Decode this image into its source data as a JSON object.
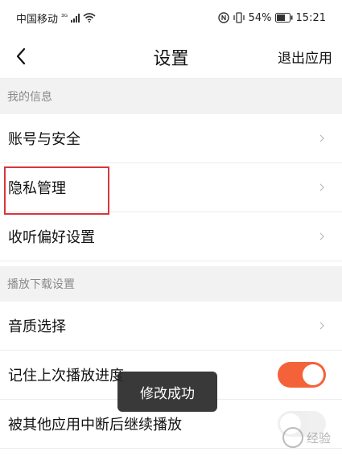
{
  "status_bar": {
    "carrier": "中国移动",
    "network": "³ᴳ",
    "battery": "54%",
    "time": "15:21"
  },
  "nav": {
    "title": "设置",
    "exit_label": "退出应用"
  },
  "sections": [
    {
      "header": "我的信息",
      "items": [
        {
          "label": "账号与安全"
        },
        {
          "label": "隐私管理"
        },
        {
          "label": "收听偏好设置"
        }
      ]
    },
    {
      "header": "播放下载设置",
      "items": [
        {
          "label": "音质选择"
        },
        {
          "label": "记住上次播放进度",
          "toggle": "on"
        },
        {
          "label": "被其他应用中断后继续播放",
          "toggle": "off"
        }
      ]
    }
  ],
  "toast": "修改成功",
  "watermark": "经验",
  "colors": {
    "toggle_on": "#f4623a",
    "highlight": "#d9363e"
  }
}
